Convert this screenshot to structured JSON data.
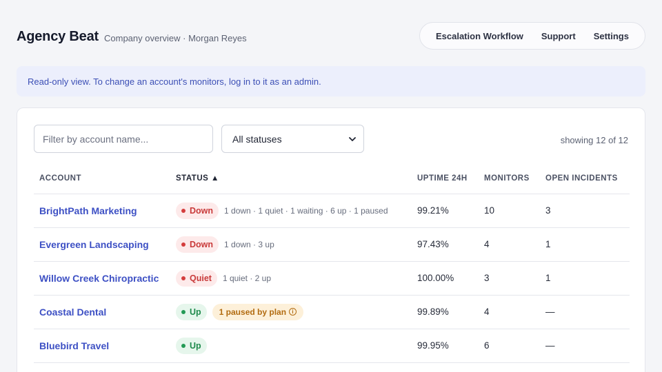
{
  "header": {
    "brand": "Agency Beat",
    "subtitle": "Company overview · Morgan Reyes",
    "nav": [
      "Escalation Workflow",
      "Support",
      "Settings"
    ]
  },
  "notice": "Read-only view. To change an account's monitors, log in to it as an admin.",
  "filters": {
    "search_placeholder": "Filter by account name...",
    "status_selected": "All statuses",
    "count_text": "showing 12 of 12"
  },
  "table": {
    "columns": [
      "ACCOUNT",
      "STATUS ▲",
      "UPTIME 24H",
      "MONITORS",
      "OPEN INCIDENTS"
    ],
    "rows": [
      {
        "account": "BrightPath Marketing",
        "status": "Down",
        "status_kind": "down",
        "detail": "1 down · 1 quiet · 1 waiting · 6 up · 1 paused",
        "plan_note": "",
        "uptime": "99.21%",
        "monitors": "10",
        "incidents": "3"
      },
      {
        "account": "Evergreen Landscaping",
        "status": "Down",
        "status_kind": "down",
        "detail": "1 down · 3 up",
        "plan_note": "",
        "uptime": "97.43%",
        "monitors": "4",
        "incidents": "1"
      },
      {
        "account": "Willow Creek Chiropractic",
        "status": "Quiet",
        "status_kind": "down",
        "detail": "1 quiet · 2 up",
        "plan_note": "",
        "uptime": "100.00%",
        "monitors": "3",
        "incidents": "1"
      },
      {
        "account": "Coastal Dental",
        "status": "Up",
        "status_kind": "up",
        "detail": "",
        "plan_note": "1 paused by plan",
        "uptime": "99.89%",
        "monitors": "4",
        "incidents": "—"
      },
      {
        "account": "Bluebird Travel",
        "status": "Up",
        "status_kind": "up",
        "detail": "",
        "plan_note": "",
        "uptime": "99.95%",
        "monitors": "6",
        "incidents": "—"
      }
    ]
  },
  "colors": {
    "accent": "#3d50c4",
    "down": "#d43d3d",
    "up": "#239a55",
    "plan": "#b26b10"
  }
}
